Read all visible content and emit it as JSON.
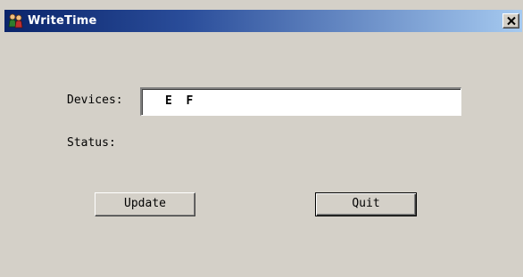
{
  "window": {
    "title": "WriteTime",
    "app_icon": "people-app-icon",
    "close_icon": "close-icon"
  },
  "form": {
    "devices_label": "Devices:",
    "devices_value": "E  F",
    "status_label": "Status:"
  },
  "buttons": {
    "update_label": "Update",
    "quit_label": "Quit"
  },
  "colors": {
    "title_start": "#0a246a",
    "title_end": "#a6caf0",
    "face": "#d4d0c8"
  }
}
